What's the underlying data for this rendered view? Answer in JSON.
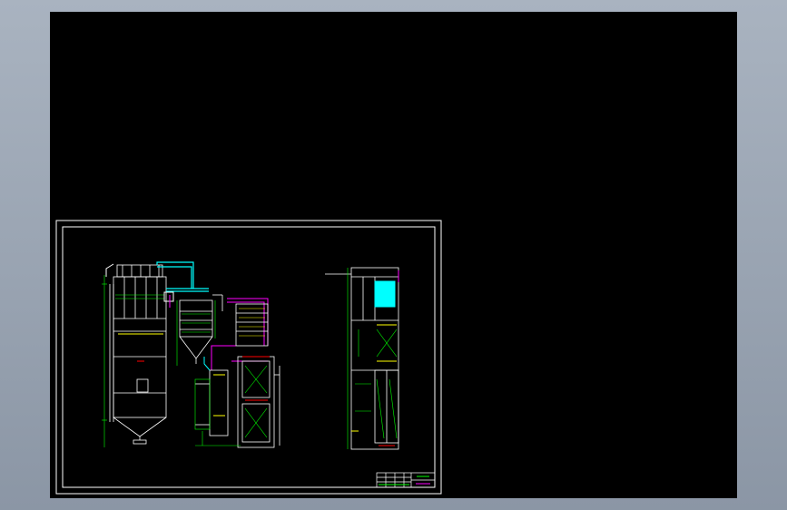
{
  "viewport": {
    "background": "#000000"
  },
  "drawing": {
    "title_block_text": "",
    "colors": {
      "frame": "#ffffff",
      "equipment": "#ffffff",
      "duct": "#00ffff",
      "pipe": "#ff00ff",
      "dimension": "#00ff00",
      "highlight": "#ffff00",
      "warning": "#ff0000"
    }
  }
}
